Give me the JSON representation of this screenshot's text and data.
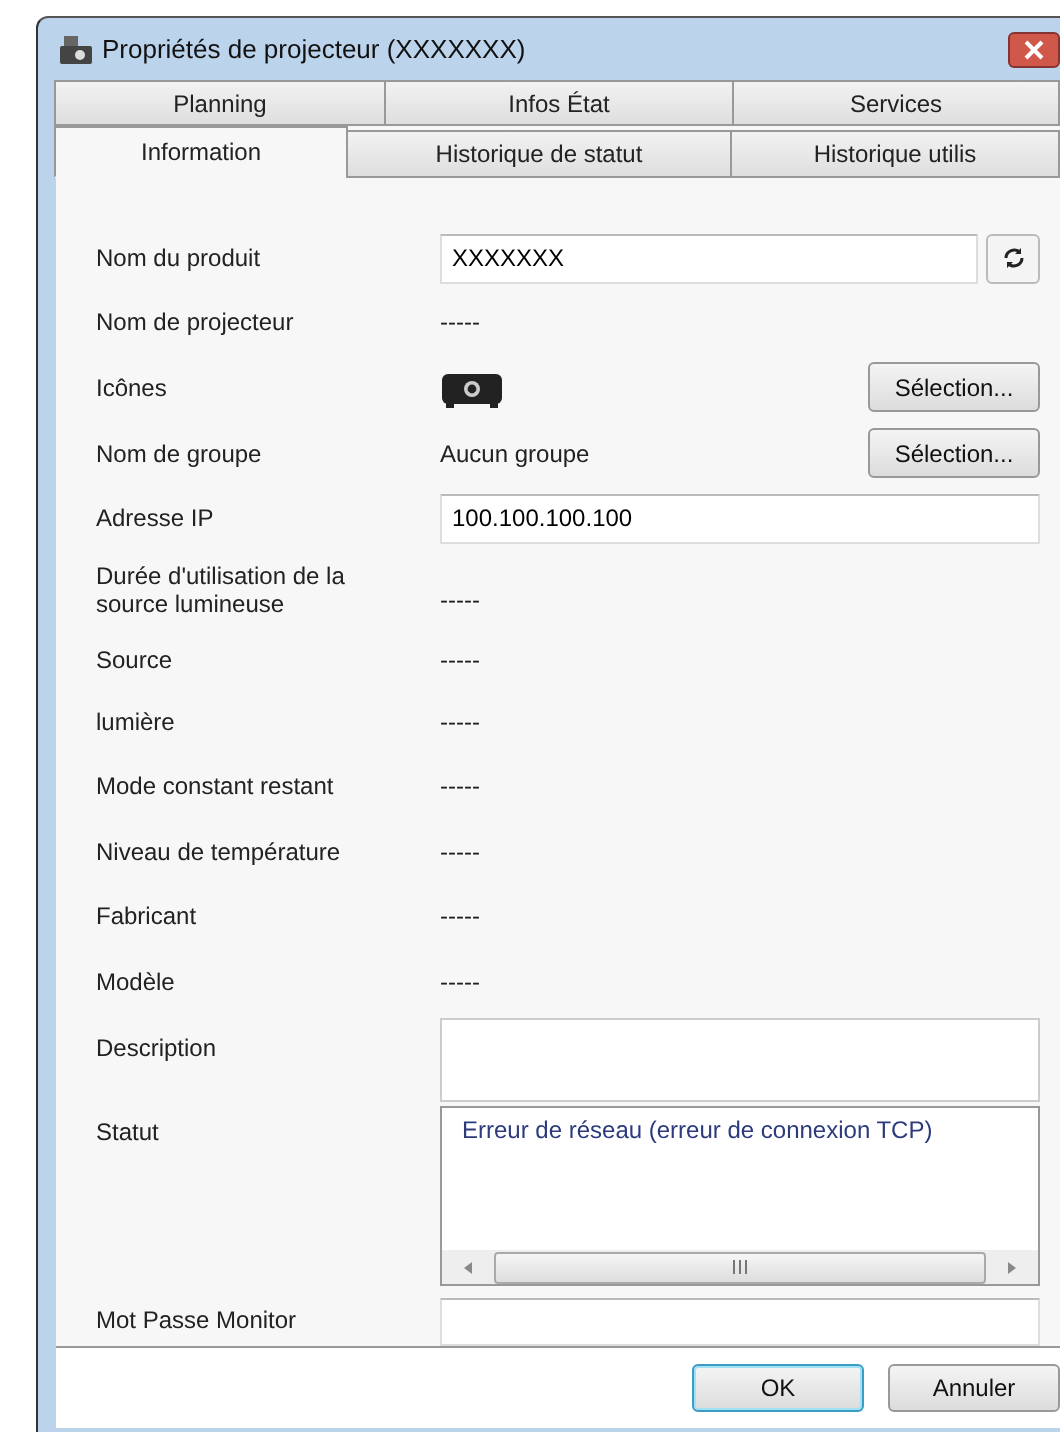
{
  "window": {
    "title": "Propriétés de projecteur (XXXXXXX)"
  },
  "tabs": [
    [
      {
        "label": "Planning",
        "selected": false
      },
      {
        "label": "Infos État",
        "selected": false
      },
      {
        "label": "Services",
        "selected": false
      }
    ],
    [
      {
        "label": "Information",
        "selected": true
      },
      {
        "label": "Historique de statut",
        "selected": false
      },
      {
        "label": "Historique utilis",
        "selected": false
      }
    ]
  ],
  "fields": [
    {
      "kind": "input",
      "label": "Nom du produit",
      "value": "XXXXXXX",
      "refresh": true
    },
    {
      "kind": "text",
      "label": "Nom de projecteur",
      "value": "-----"
    },
    {
      "kind": "icon",
      "label": "Icônes",
      "button": "Sélection..."
    },
    {
      "kind": "text",
      "label": "Nom de groupe",
      "value": "Aucun groupe",
      "button": "Sélection..."
    },
    {
      "kind": "input",
      "label": "Adresse IP",
      "value": "100.100.100.100"
    },
    {
      "kind": "text",
      "label": "Durée d'utilisation de la source lumineuse",
      "value": "-----"
    },
    {
      "kind": "text",
      "label": "Source",
      "value": "-----"
    },
    {
      "kind": "text",
      "label": "lumière",
      "value": "-----"
    },
    {
      "kind": "text",
      "label": "Mode constant restant",
      "value": "-----"
    },
    {
      "kind": "text",
      "label": "Niveau de température",
      "value": "-----"
    },
    {
      "kind": "text",
      "label": "Fabricant",
      "value": "-----"
    },
    {
      "kind": "text",
      "label": "Modèle",
      "value": "-----"
    },
    {
      "kind": "textarea",
      "label": "Description"
    },
    {
      "kind": "status",
      "label": "Statut",
      "value": "Erreur de réseau (erreur de connexion TCP)"
    },
    {
      "kind": "password",
      "label": "Mot Passe Monitor"
    }
  ],
  "buttons": [
    "OK",
    "Annuler"
  ]
}
